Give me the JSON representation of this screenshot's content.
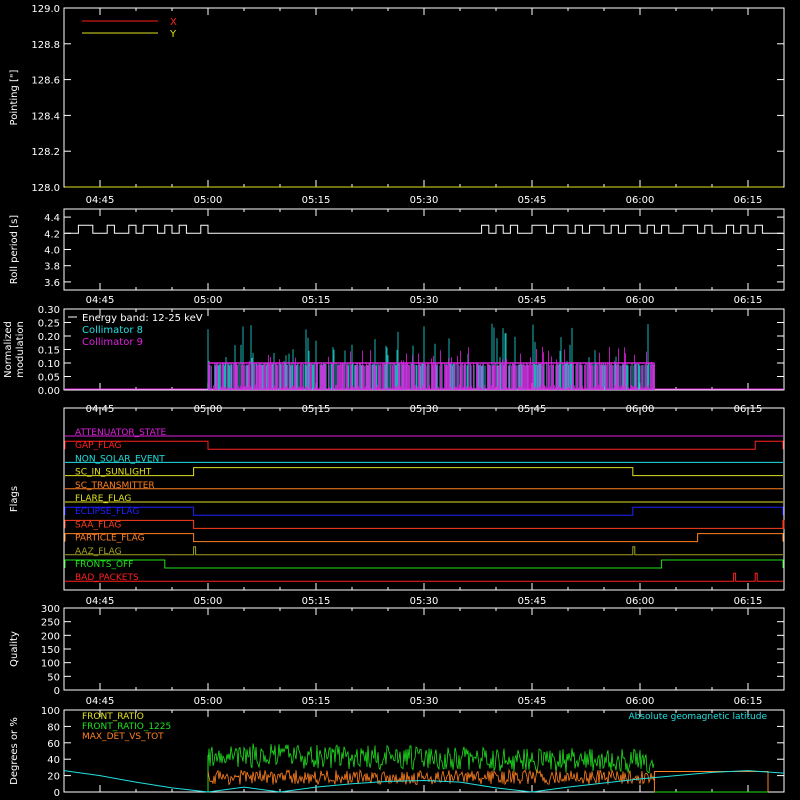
{
  "colors": {
    "background": "#000000",
    "axis": "#ffffff",
    "red": "#ff2020",
    "yellow": "#e0e020",
    "cyan": "#20e0e0",
    "magenta": "#e020e0",
    "orange": "#ff8020",
    "green": "#20e020",
    "blue": "#2020ff",
    "olive": "#a0a020",
    "rust": "#ff4020"
  },
  "time_ticks": [
    "04:45",
    "05:00",
    "05:15",
    "05:30",
    "05:45",
    "06:00",
    "06:15"
  ],
  "chart_data": [
    {
      "type": "line",
      "id": "pointing",
      "ylabel": "Pointing [\"]",
      "ylim": [
        128.0,
        129.0
      ],
      "yticks": [
        "128.0",
        "128.2",
        "128.4",
        "128.6",
        "128.8",
        "129.0"
      ],
      "legend": [
        {
          "name": "X",
          "color": "#ff2020"
        },
        {
          "name": "Y",
          "color": "#e0e020"
        }
      ],
      "series": [
        {
          "name": "Y",
          "color": "#e0e020",
          "constant": 128.0
        }
      ]
    },
    {
      "type": "line",
      "id": "roll",
      "ylabel": "Roll period [s]",
      "ylim": [
        3.5,
        4.5
      ],
      "yticks": [
        "3.6",
        "3.8",
        "4.0",
        "4.2",
        "4.4"
      ],
      "series": [
        {
          "name": "",
          "color": "#ffffff",
          "baseline": 4.2,
          "pulses": [
            [
              "04:42",
              "04:44"
            ],
            [
              "04:46",
              "04:47"
            ],
            [
              "04:49",
              "04:50"
            ],
            [
              "04:51",
              "04:53"
            ],
            [
              "04:54",
              "04:55"
            ],
            [
              "04:56",
              "04:57"
            ],
            [
              "04:59",
              "05:00"
            ],
            [
              "05:38",
              "05:39"
            ],
            [
              "05:40",
              "05:41"
            ],
            [
              "05:42",
              "05:43"
            ],
            [
              "05:45",
              "05:47"
            ],
            [
              "05:48",
              "05:50"
            ],
            [
              "05:51",
              "05:52"
            ],
            [
              "05:53",
              "05:55"
            ],
            [
              "05:56",
              "05:57"
            ],
            [
              "05:58",
              "06:00"
            ],
            [
              "06:01",
              "06:02"
            ],
            [
              "06:03",
              "06:04"
            ],
            [
              "06:06",
              "06:08"
            ],
            [
              "06:09",
              "06:10"
            ],
            [
              "06:12",
              "06:13"
            ],
            [
              "06:14",
              "06:15"
            ],
            [
              "06:16",
              "06:17"
            ]
          ],
          "peak": 4.3
        }
      ]
    },
    {
      "type": "line",
      "id": "modulation",
      "ylabel": "Normalized modulation",
      "ylim": [
        0,
        0.3
      ],
      "yticks": [
        "0.00",
        "0.05",
        "0.10",
        "0.15",
        "0.20",
        "0.25",
        "0.30"
      ],
      "legend": [
        {
          "name": "Energy band: 12-25 keV",
          "color": "#ffffff"
        },
        {
          "name": "Collimator 8",
          "color": "#20e0e0"
        },
        {
          "name": "Collimator 9",
          "color": "#e020e0"
        }
      ],
      "active_range": [
        "05:00",
        "06:02"
      ],
      "typical_value": 0.1
    },
    {
      "type": "line",
      "id": "flags",
      "ylabel": "Flags",
      "flags": [
        {
          "name": "ATTENUATOR_STATE",
          "color": "#e020e0",
          "segments": []
        },
        {
          "name": "GAP_FLAG",
          "color": "#ff2020",
          "segments": [
            [
              "04:40",
              "05:00"
            ],
            [
              "06:16",
              "06:20"
            ]
          ]
        },
        {
          "name": "NON_SOLAR_EVENT",
          "color": "#20e0e0",
          "segments": []
        },
        {
          "name": "SC_IN_SUNLIGHT",
          "color": "#e0e020",
          "segments": [
            [
              "04:58",
              "05:59"
            ]
          ]
        },
        {
          "name": "SC_TRANSMITTER",
          "color": "#ff8020",
          "segments": []
        },
        {
          "name": "FLARE_FLAG",
          "color": "#e0e020",
          "segments": []
        },
        {
          "name": "ECLIPSE_FLAG",
          "color": "#2020ff",
          "segments": [
            [
              "04:40",
              "04:58"
            ],
            [
              "05:59",
              "06:20"
            ]
          ]
        },
        {
          "name": "SAA_FLAG",
          "color": "#ff4020",
          "segments": [
            [
              "04:40",
              "04:58"
            ],
            [
              "06:20",
              "06:20"
            ]
          ]
        },
        {
          "name": "PARTICLE_FLAG",
          "color": "#ff8020",
          "segments": [
            [
              "04:40",
              "04:58"
            ],
            [
              "06:08",
              "06:20"
            ]
          ]
        },
        {
          "name": "AAZ_FLAG",
          "color": "#a0a020",
          "segments": [
            [
              "04:58",
              "04:58"
            ],
            [
              "05:59",
              "05:59"
            ]
          ]
        },
        {
          "name": "FRONTS_OFF",
          "color": "#20e020",
          "segments": [
            [
              "04:40",
              "04:54"
            ],
            [
              "06:03",
              "06:20"
            ]
          ]
        },
        {
          "name": "BAD_PACKETS",
          "color": "#ff2020",
          "segments": [
            [
              "06:13",
              "06:13"
            ],
            [
              "06:16",
              "06:16"
            ]
          ]
        }
      ]
    },
    {
      "type": "line",
      "id": "quality",
      "ylabel": "Quality",
      "ylim": [
        0,
        300
      ],
      "yticks": [
        "0",
        "50",
        "100",
        "150",
        "200",
        "250",
        "300"
      ],
      "series": []
    },
    {
      "type": "line",
      "id": "ratio",
      "ylabel": "Degrees or %",
      "ylim": [
        0,
        100
      ],
      "yticks": [
        "0",
        "20",
        "40",
        "60",
        "80",
        "100"
      ],
      "legend": [
        {
          "name": "FRONT_RATIO",
          "color": "#e0e020"
        },
        {
          "name": "FRONT_RATIO_1225",
          "color": "#20e020"
        },
        {
          "name": "MAX_DET_VS_TOT",
          "color": "#ff8020"
        }
      ],
      "annotation": "Absolute geomagnetic latitude",
      "annotation_color": "#20e0e0",
      "latitude": [
        [
          "04:40",
          26
        ],
        [
          "04:45",
          20
        ],
        [
          "04:50",
          12
        ],
        [
          "04:55",
          5
        ],
        [
          "05:00",
          0
        ],
        [
          "05:05",
          6
        ],
        [
          "05:10",
          0
        ],
        [
          "05:15",
          6
        ],
        [
          "05:20",
          10
        ],
        [
          "05:25",
          13
        ],
        [
          "05:30",
          14
        ],
        [
          "05:35",
          12
        ],
        [
          "05:40",
          5
        ],
        [
          "05:45",
          0
        ],
        [
          "05:50",
          6
        ],
        [
          "05:55",
          11
        ],
        [
          "06:00",
          16
        ],
        [
          "06:05",
          20
        ],
        [
          "06:10",
          24
        ],
        [
          "06:15",
          26
        ],
        [
          "06:20",
          23
        ]
      ],
      "front_ratio_1225_typical": 45,
      "max_det_vs_tot_typical": 18,
      "active_range": [
        "05:00",
        "06:02"
      ],
      "post_level": 25
    }
  ]
}
